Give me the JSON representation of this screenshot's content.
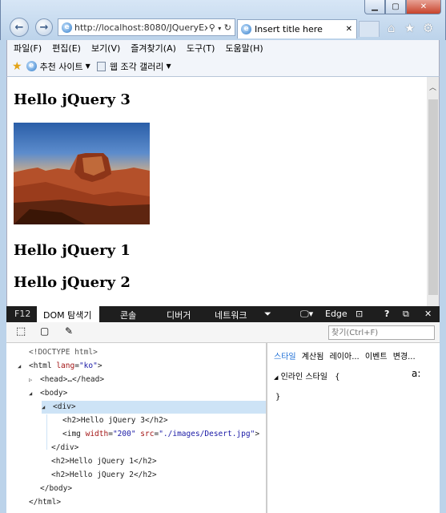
{
  "browser": {
    "address": "http://localhost:8080/JQueryEx",
    "tab_title": "Insert title here",
    "menu": [
      "파일(F)",
      "편집(E)",
      "보기(V)",
      "즐겨찾기(A)",
      "도구(T)",
      "도움말(H)"
    ],
    "favorites": [
      "추천 사이트",
      "웹 조각 갤러리"
    ]
  },
  "page": {
    "headings": [
      "Hello jQuery 3",
      "Hello jQuery 1",
      "Hello jQuery 2"
    ]
  },
  "devtools": {
    "f12": "F12",
    "tabs": [
      "DOM 탐색기",
      "콘솔",
      "디버거",
      "네트워크"
    ],
    "mode": "Edge",
    "search_placeholder": "찾기(Ctrl+F)",
    "dom_lines": [
      {
        "indent": 0,
        "arrow": "",
        "parts": [
          [
            "gy",
            "<!DOCTYPE html>"
          ]
        ]
      },
      {
        "indent": 0,
        "arrow": "◢",
        "parts": [
          [
            "tg",
            "<html "
          ],
          [
            "an",
            "lang"
          ],
          [
            "tg",
            "="
          ],
          [
            "av",
            "\"ko\""
          ],
          [
            "tg",
            ">"
          ]
        ]
      },
      {
        "indent": 1,
        "arrow": "▷",
        "parts": [
          [
            "tg",
            "<head>…</head>"
          ]
        ]
      },
      {
        "indent": 1,
        "arrow": "◢",
        "parts": [
          [
            "tg",
            "<body>"
          ]
        ]
      },
      {
        "indent": 2,
        "arrow": "◢",
        "parts": [
          [
            "tg",
            "<div>"
          ]
        ],
        "selected": true
      },
      {
        "indent": 3,
        "arrow": "",
        "parts": [
          [
            "tg",
            "<h2>Hello jQuery 3</h2>"
          ]
        ]
      },
      {
        "indent": 3,
        "arrow": "",
        "parts": [
          [
            "tg",
            "<img "
          ],
          [
            "an",
            "width"
          ],
          [
            "tg",
            "="
          ],
          [
            "av",
            "\"200\""
          ],
          [
            "tg",
            " "
          ],
          [
            "an",
            "src"
          ],
          [
            "tg",
            "="
          ],
          [
            "av",
            "\"./images/Desert.jpg\""
          ],
          [
            "tg",
            ">"
          ]
        ]
      },
      {
        "indent": 2,
        "arrow": "",
        "parts": [
          [
            "tg",
            "</div>"
          ]
        ]
      },
      {
        "indent": 2,
        "arrow": "",
        "parts": [
          [
            "tg",
            "<h2>Hello jQuery 1</h2>"
          ]
        ]
      },
      {
        "indent": 2,
        "arrow": "",
        "parts": [
          [
            "tg",
            "<h2>Hello jQuery 2</h2>"
          ]
        ]
      },
      {
        "indent": 1,
        "arrow": "",
        "parts": [
          [
            "tg",
            "</body>"
          ]
        ]
      },
      {
        "indent": 0,
        "arrow": "",
        "parts": [
          [
            "tg",
            "</html>"
          ]
        ]
      }
    ],
    "side_tabs": [
      "스타일",
      "계산됨",
      "레이아...",
      "이벤트",
      "변경..."
    ],
    "inline_style_label": "인라인 스타일",
    "open_brace": "{",
    "close_brace": "}",
    "font_glyph": "a:"
  }
}
